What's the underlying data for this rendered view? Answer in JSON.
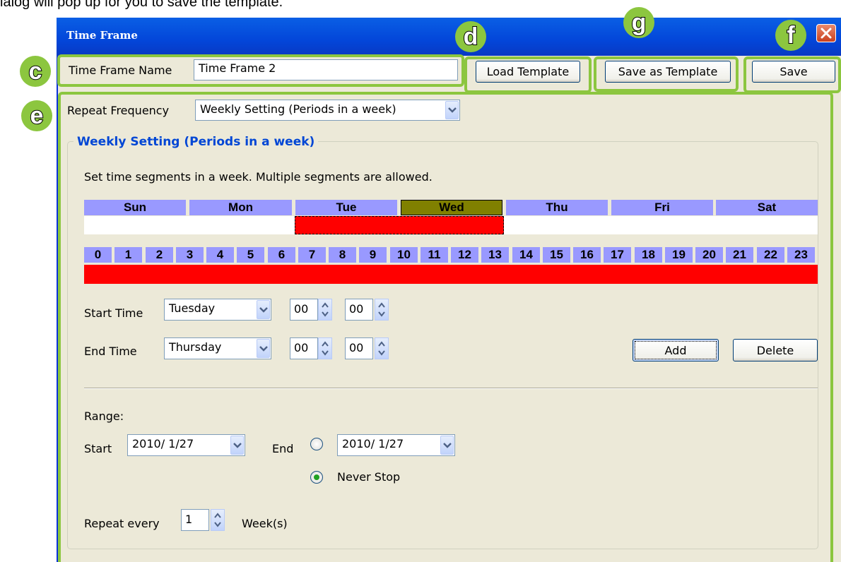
{
  "caption": "ialog will pop up for you to save the template.",
  "window": {
    "title": "Time Frame"
  },
  "badges": {
    "c": "c",
    "d": "d",
    "e": "e",
    "f": "f",
    "g": "g"
  },
  "name_row": {
    "label": "Time Frame Name",
    "value": "Time Frame 2"
  },
  "buttons": {
    "load_template": "Load Template",
    "save_as_template": "Save as Template",
    "save": "Save",
    "add": "Add",
    "delete": "Delete"
  },
  "repeat": {
    "label": "Repeat Frequency",
    "value": "Weekly Setting (Periods in a week)"
  },
  "weekly": {
    "group_title": "Weekly Setting (Periods in a week)",
    "instruction": "Set time segments in a week. Multiple segments are allowed.",
    "days": [
      "Sun",
      "Mon",
      "Tue",
      "Wed",
      "Thu",
      "Fri",
      "Sat"
    ],
    "highlighted_day": "Wed",
    "hours": [
      "0",
      "1",
      "2",
      "3",
      "4",
      "5",
      "6",
      "7",
      "8",
      "9",
      "10",
      "11",
      "12",
      "13",
      "14",
      "15",
      "16",
      "17",
      "18",
      "19",
      "20",
      "21",
      "22",
      "23"
    ]
  },
  "start_time": {
    "label": "Start Time",
    "day": "Tuesday",
    "hour": "00",
    "minute": "00"
  },
  "end_time": {
    "label": "End Time",
    "day": "Thursday",
    "hour": "00",
    "minute": "00"
  },
  "range": {
    "label": "Range:",
    "start_label": "Start",
    "start_date": "2010/ 1/27",
    "end_label": "End",
    "end_date": "2010/ 1/27",
    "never_stop": "Never Stop"
  },
  "repeat_every": {
    "label": "Repeat every",
    "value": "1",
    "unit": "Week(s)"
  },
  "colors": {
    "day_header": "#9999FF",
    "selected_segment": "#FF0000",
    "highlight_day": "#808000",
    "annotation": "#8CC63F",
    "titlebar": "#0A5FE5"
  }
}
